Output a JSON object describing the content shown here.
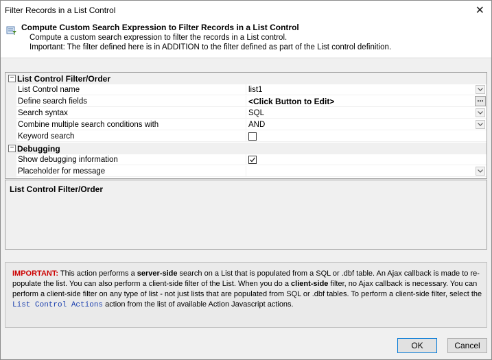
{
  "window": {
    "title": "Filter Records in a List Control",
    "close_label": "✕"
  },
  "header": {
    "title": "Compute Custom Search Expression to Filter Records in a List Control",
    "desc1": "Compute a custom search expression to filter the records in a List control.",
    "desc2": "Important: The filter defined here is in ADDITION to the filter defined as part of the List control definition."
  },
  "grid": {
    "category1": "List Control Filter/Order",
    "category2": "Debugging",
    "toggle": "−",
    "rows": [
      {
        "name": "List Control name",
        "value": "list1"
      },
      {
        "name": "Define search fields",
        "value": "<Click Button to Edit>"
      },
      {
        "name": "Search syntax",
        "value": "SQL"
      },
      {
        "name": "Combine multiple search conditions with",
        "value": "AND"
      },
      {
        "name": "Keyword search",
        "value": ""
      },
      {
        "name": "Show debugging information",
        "value": ""
      },
      {
        "name": "Placeholder for message",
        "value": ""
      }
    ],
    "ellipsis": "..."
  },
  "help": {
    "title": "List Control Filter/Order"
  },
  "note": {
    "important": "IMPORTANT:",
    "p1": " This action performs a ",
    "b1": "server-side",
    "p2": " search on a List that is populated from a SQL or .dbf table. An Ajax callback is made to re-populate the list. You can also perform a client-side filter of the List. When you do a ",
    "b2": "client-side",
    "p3": " filter, no Ajax callback is necessary. You can perform a client-side filter on any type of list - not just lists that are populated from SQL or .dbf tables. To perform a client-side filter, select the ",
    "mono": "List Control Actions",
    "p4": " action from the list of available Action Javascript actions."
  },
  "buttons": {
    "ok": "OK",
    "cancel": "Cancel"
  }
}
